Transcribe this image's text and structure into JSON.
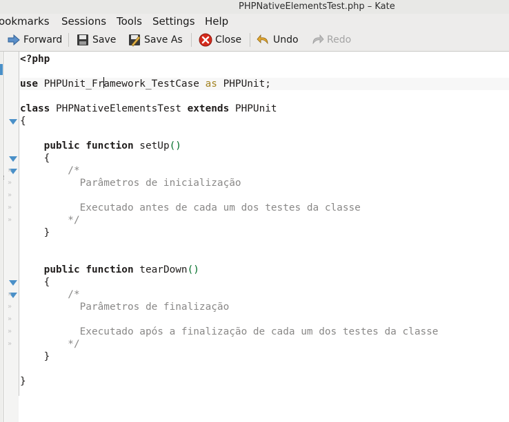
{
  "window": {
    "title": "PHPNativeElementsTest.php – Kate"
  },
  "menubar": {
    "items": [
      {
        "label": "ookmarks"
      },
      {
        "label": "Sessions"
      },
      {
        "label": "Tools"
      },
      {
        "label": "Settings"
      },
      {
        "label": "Help"
      }
    ]
  },
  "toolbar": {
    "forward_label": "Forward",
    "save_label": "Save",
    "save_as_label": "Save As",
    "close_label": "Close",
    "undo_label": "Undo",
    "redo_label": "Redo",
    "icons": [
      "arrow-right-icon",
      "floppy-disk-icon",
      "save-as-icon",
      "close-icon",
      "undo-icon",
      "redo-icon"
    ],
    "colors": {
      "close_red": "#d42a1c",
      "accent_blue": "#4a90c8"
    }
  },
  "editor": {
    "lines": [
      {
        "tokens": [
          {
            "t": "<?php",
            "c": "kw"
          }
        ]
      },
      {
        "tokens": []
      },
      {
        "tokens": [
          {
            "t": "use",
            "c": "kw"
          },
          {
            "t": " PHPUnit_Framework_TestCase ",
            "c": "plain"
          },
          {
            "t": "as",
            "c": "as"
          },
          {
            "t": " PHPUnit;",
            "c": "plain"
          }
        ]
      },
      {
        "tokens": []
      },
      {
        "tokens": [
          {
            "t": "class",
            "c": "kw"
          },
          {
            "t": " PHPNativeElementsTest ",
            "c": "plain"
          },
          {
            "t": "extends",
            "c": "kw"
          },
          {
            "t": " PHPUnit",
            "c": "plain"
          }
        ]
      },
      {
        "tokens": [
          {
            "t": "{",
            "c": "plain"
          }
        ]
      },
      {
        "tokens": []
      },
      {
        "tokens": [
          {
            "t": "    ",
            "c": "plain"
          },
          {
            "t": "public",
            "c": "kw"
          },
          {
            "t": " ",
            "c": "plain"
          },
          {
            "t": "function",
            "c": "kw"
          },
          {
            "t": " setUp",
            "c": "plain"
          },
          {
            "t": "()",
            "c": "paren"
          }
        ]
      },
      {
        "tokens": [
          {
            "t": "    {",
            "c": "plain"
          }
        ]
      },
      {
        "tokens": [
          {
            "t": "        /*",
            "c": "cmt"
          }
        ]
      },
      {
        "tokens": [
          {
            "t": "          Parâmetros de inicialização",
            "c": "cmt"
          }
        ]
      },
      {
        "tokens": []
      },
      {
        "tokens": [
          {
            "t": "          Executado antes de cada um dos testes da classe",
            "c": "cmt"
          }
        ]
      },
      {
        "tokens": [
          {
            "t": "        */",
            "c": "cmt"
          }
        ]
      },
      {
        "tokens": [
          {
            "t": "    }",
            "c": "plain"
          }
        ]
      },
      {
        "tokens": []
      },
      {
        "tokens": []
      },
      {
        "tokens": [
          {
            "t": "    ",
            "c": "plain"
          },
          {
            "t": "public",
            "c": "kw"
          },
          {
            "t": " ",
            "c": "plain"
          },
          {
            "t": "function",
            "c": "kw"
          },
          {
            "t": " tearDown",
            "c": "plain"
          },
          {
            "t": "()",
            "c": "paren"
          }
        ]
      },
      {
        "tokens": [
          {
            "t": "    {",
            "c": "plain"
          }
        ]
      },
      {
        "tokens": [
          {
            "t": "        /*",
            "c": "cmt"
          }
        ]
      },
      {
        "tokens": [
          {
            "t": "          Parâmetros de finalização",
            "c": "cmt"
          }
        ]
      },
      {
        "tokens": []
      },
      {
        "tokens": [
          {
            "t": "          Executado após a finalização de cada um dos testes da classe",
            "c": "cmt"
          }
        ]
      },
      {
        "tokens": [
          {
            "t": "        */",
            "c": "cmt"
          }
        ]
      },
      {
        "tokens": [
          {
            "t": "    }",
            "c": "plain"
          }
        ]
      },
      {
        "tokens": []
      },
      {
        "tokens": [
          {
            "t": "}",
            "c": "plain"
          }
        ]
      }
    ],
    "current_line": 2,
    "fold_lines": [
      5,
      8,
      9,
      18,
      19
    ],
    "wrap_marker_glyph": "»",
    "wrap_marker_lines": [
      9,
      10,
      11,
      12,
      13,
      19,
      20,
      21,
      22,
      23
    ]
  }
}
